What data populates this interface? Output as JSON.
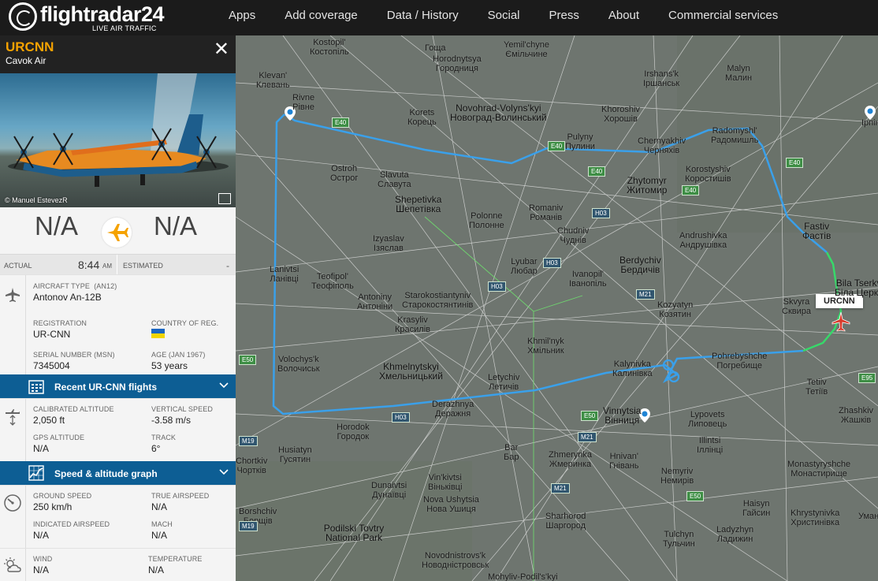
{
  "brand": {
    "name": "flightradar24",
    "tagline": "LIVE AIR TRAFFIC"
  },
  "nav": [
    "Apps",
    "Add coverage",
    "Data / History",
    "Social",
    "Press",
    "About",
    "Commercial services"
  ],
  "flight": {
    "callsign": "URCNN",
    "airline": "Cavok Air",
    "photo_credit": "© Manuel EstevezR",
    "origin": "N/A",
    "destination": "N/A",
    "actual_label": "ACTUAL",
    "actual_time": "8:44",
    "actual_ampm": "AM",
    "estimated_label": "ESTIMATED",
    "estimated_time": "-"
  },
  "aircraft": {
    "type_label": "AIRCRAFT TYPE",
    "type_code": "(AN12)",
    "type_value": "Antonov An-12B",
    "registration_label": "REGISTRATION",
    "registration_value": "UR-CNN",
    "country_label": "COUNTRY OF REG.",
    "serial_label": "SERIAL NUMBER (MSN)",
    "serial_value": "7345004",
    "age_label": "AGE (JAN 1967)",
    "age_value": "53 years"
  },
  "recent_bar": "Recent UR-CNN flights",
  "altitude": {
    "cal_alt_label": "CALIBRATED ALTITUDE",
    "cal_alt_value": "2,050 ft",
    "vs_label": "VERTICAL SPEED",
    "vs_value": "-3.58 m/s",
    "gps_label": "GPS ALTITUDE",
    "gps_value": "N/A",
    "track_label": "TRACK",
    "track_value": "6°"
  },
  "graph_bar": "Speed & altitude graph",
  "speed": {
    "gs_label": "GROUND SPEED",
    "gs_value": "250 km/h",
    "tas_label": "TRUE AIRSPEED",
    "tas_value": "N/A",
    "ias_label": "INDICATED AIRSPEED",
    "ias_value": "N/A",
    "mach_label": "MACH",
    "mach_value": "N/A"
  },
  "weather": {
    "wind_label": "WIND",
    "wind_value": "N/A",
    "temp_label": "TEMPERATURE",
    "temp_value": "N/A"
  },
  "map": {
    "aircraft_label": "URCNN",
    "cities": [
      [
        "Kostopil'",
        "Костопіль"
      ],
      [
        "Yemil'chyne",
        "Ємільчине"
      ],
      [
        "Kostopil",
        ""
      ],
      [
        "Hoshcha",
        "Гоща"
      ],
      [
        "Klevan'",
        "Клевань"
      ],
      [
        "Rivne",
        "Рівне"
      ],
      [
        "Horodnytsya",
        "Городниця"
      ],
      [
        "Irshans'k",
        "Іршанськ"
      ],
      [
        "Malyn",
        "Малин"
      ],
      [
        "Korets",
        "Корець"
      ],
      [
        "Novohrad-Volyns'kyi",
        "Новоград-Волинський"
      ],
      [
        "Khoroshiv",
        "Хорошів"
      ],
      [
        "Radomyshl'",
        "Радомишль"
      ],
      [
        "Pulyny",
        "Пулини"
      ],
      [
        "Chernyakhiv",
        "Черняхів"
      ],
      [
        "Ostroh",
        "Острог"
      ],
      [
        "Slavuta",
        "Славута"
      ],
      [
        "Zhytomyr",
        "Житомир"
      ],
      [
        "Korostyshiv",
        "Коростишів"
      ],
      [
        "Shepetivka",
        "Шепетівка"
      ],
      [
        "Romaniv",
        "Романів"
      ],
      [
        "Fastiv",
        "Фастів"
      ],
      [
        "Polonne",
        "Полонне"
      ],
      [
        "Chudniv",
        "Чуднів"
      ],
      [
        "Andrushivka",
        "Андрушівка"
      ],
      [
        "Izyaslav",
        "Ізяслав"
      ],
      [
        "Lyubar",
        "Любар"
      ],
      [
        "Berdychiv",
        "Бердичів"
      ],
      [
        "Lanivtsi",
        "Ланівці"
      ],
      [
        "Teofipol'",
        "Теофіполь"
      ],
      [
        "Ivanopil'",
        "Іванопіль"
      ],
      [
        "Bila Tserkva",
        "Біла Церква"
      ],
      [
        "Antoniny",
        "Антоніни"
      ],
      [
        "Starokostiantyniv",
        "Старокостянтинів"
      ],
      [
        "Kozyatyn",
        "Козятин"
      ],
      [
        "Skvyra",
        "Сквира"
      ],
      [
        "Krasyliv",
        "Красилів"
      ],
      [
        "Khmil'nyk",
        "Хмільник"
      ],
      [
        "Pohrebyshche",
        "Погребище"
      ],
      [
        "Volochys'k",
        "Волочиськ"
      ],
      [
        "Khmelnytskyi",
        "Хмельницький"
      ],
      [
        "Kalynivka",
        "Калинівка"
      ],
      [
        "Tetiiv",
        "Тетіїв"
      ],
      [
        "Letychiv",
        "Летичів"
      ],
      [
        "Derazhnya",
        "Деражня"
      ],
      [
        "Vinnytsia",
        "Вінниця"
      ],
      [
        "Lypovets",
        "Липовець"
      ],
      [
        "Zhashkiv",
        "Жашків"
      ],
      [
        "Horodok",
        "Городок"
      ],
      [
        "Husiatyn",
        "Гусятин"
      ],
      [
        "Bar",
        "Бар"
      ],
      [
        "Zhmerynka",
        "Жмеринка"
      ],
      [
        "Hnivan'",
        "Гнівань"
      ],
      [
        "Illintsi",
        "Іллінці"
      ],
      [
        "Monastyryshche",
        "Монастирище"
      ],
      [
        "Chortkiv",
        "Чортків"
      ],
      [
        "Vin'kivtsi",
        "Віньківці"
      ],
      [
        "Nemyriv",
        "Немирів"
      ],
      [
        "Dunaivtsi",
        "Дунаївці"
      ],
      [
        "Haisyn",
        "Гайсин"
      ],
      [
        "Khrystynivka",
        "Христинівка"
      ],
      [
        "Borshchiv",
        "Борщів"
      ],
      [
        "Nova Ushytsia",
        "Нова Ушиця"
      ],
      [
        "Sharhorod",
        "Шаргород"
      ],
      [
        "Tulchyn",
        "Тульчин"
      ],
      [
        "Ladyzhyn",
        "Ладижин"
      ],
      [
        "Podilski Tovtry National Park",
        ""
      ],
      [
        "Novodnistrovs'k",
        "Новодністровськ"
      ],
      [
        "Mohyliv-Podil's'kyi",
        ""
      ],
      [
        "Irpin",
        "Ірпінь"
      ],
      [
        "Uman",
        "Умань"
      ]
    ],
    "roads": [
      "E40",
      "E40",
      "E40",
      "E40",
      "E40",
      "H03",
      "H03",
      "H03",
      "H03",
      "M21",
      "M21",
      "E50",
      "E50",
      "E50",
      "E95",
      "M19",
      "M19",
      "M21"
    ]
  }
}
